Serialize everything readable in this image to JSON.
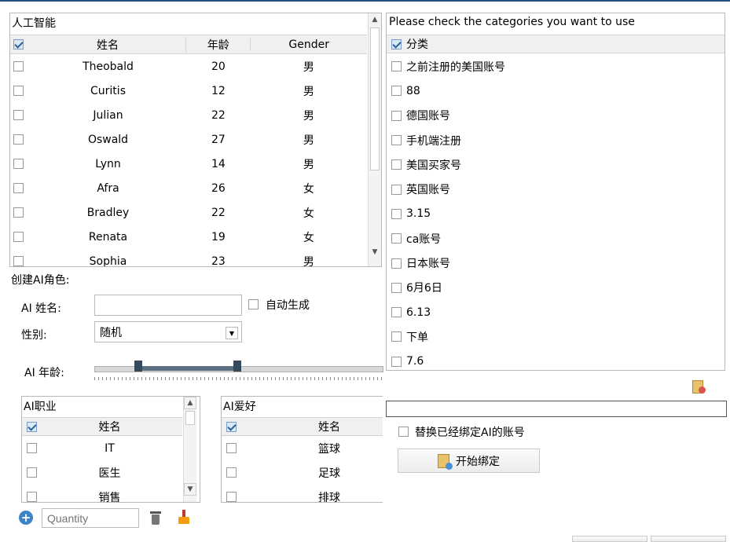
{
  "ai_table": {
    "title": "人工智能",
    "columns": [
      "姓名",
      "年龄",
      "Gender"
    ],
    "rows": [
      {
        "name": "Theobald",
        "age": "20",
        "gender": "男"
      },
      {
        "name": "Curitis",
        "age": "12",
        "gender": "男"
      },
      {
        "name": "Julian",
        "age": "22",
        "gender": "男"
      },
      {
        "name": "Oswald",
        "age": "27",
        "gender": "男"
      },
      {
        "name": "Lynn",
        "age": "14",
        "gender": "男"
      },
      {
        "name": "Afra",
        "age": "26",
        "gender": "女"
      },
      {
        "name": "Bradley",
        "age": "22",
        "gender": "女"
      },
      {
        "name": "Renata",
        "age": "19",
        "gender": "女"
      },
      {
        "name": "Sophia",
        "age": "23",
        "gender": "男"
      }
    ]
  },
  "create": {
    "section_label": "创建AI角色:",
    "name_label": "AI 姓名:",
    "name_value": "",
    "auto_generate_label": "自动生成",
    "gender_label": "性别:",
    "gender_value": "随机",
    "age_label": "AI 年龄:"
  },
  "jobs": {
    "title": "AI职业",
    "column": "姓名",
    "items": [
      "IT",
      "医生",
      "销售"
    ]
  },
  "hobbies": {
    "title": "AI爱好",
    "column": "姓名",
    "items": [
      "篮球",
      "足球",
      "排球"
    ]
  },
  "bottom": {
    "quantity_placeholder": "Quantity"
  },
  "categories": {
    "prompt": "Please check the categories you want to use",
    "header": "分类",
    "items": [
      "之前注册的美国账号",
      "88",
      "德国账号",
      "手机端注册",
      "美国买家号",
      "英国账号",
      "3.15",
      "ca账号",
      "日本账号",
      "6月6日",
      "6.13",
      "下单",
      "7.6"
    ]
  },
  "bind": {
    "replace_label": "替换已经绑定AI的账号",
    "start_label": "开始绑定",
    "status_value": ""
  }
}
